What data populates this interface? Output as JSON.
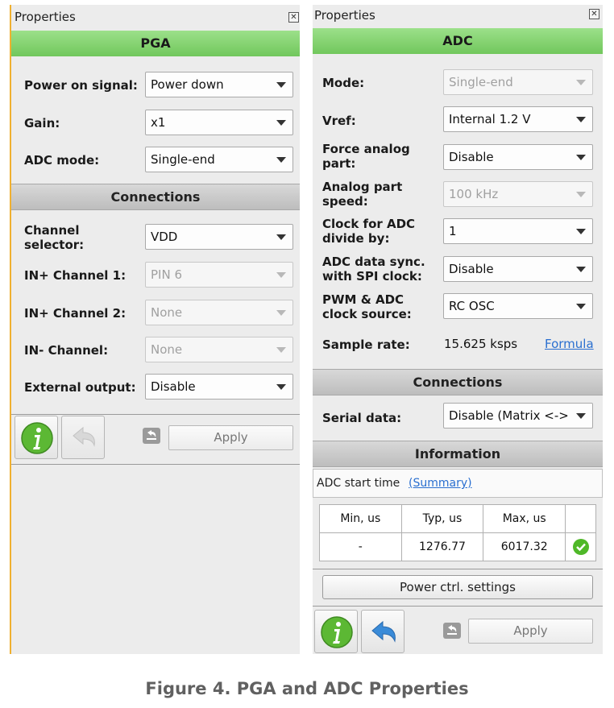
{
  "pga_panel": {
    "window_title": "Properties",
    "header": "PGA",
    "fields": [
      {
        "label": "Power on signal:",
        "value": "Power down"
      },
      {
        "label": "Gain:",
        "value": "x1"
      },
      {
        "label": "ADC mode:",
        "value": "Single-end"
      }
    ],
    "connections_header": "Connections",
    "connections": [
      {
        "label": "Channel selector:",
        "value": "VDD"
      },
      {
        "label": "IN+ Channel 1:",
        "value": "PIN 6"
      },
      {
        "label": "IN+ Channel 2:",
        "value": "None"
      },
      {
        "label": "IN- Channel:",
        "value": "None"
      },
      {
        "label": "External output:",
        "value": "Disable"
      }
    ],
    "apply_label": "Apply"
  },
  "adc_panel": {
    "window_title": "Properties",
    "header": "ADC",
    "fields": [
      {
        "label": "Mode:",
        "value": "Single-end"
      },
      {
        "label": "Vref:",
        "value": "Internal 1.2 V"
      },
      {
        "label": "Force analog part:",
        "value": "Disable"
      },
      {
        "label": "Analog part speed:",
        "value": "100 kHz"
      },
      {
        "label": "Clock for ADC divide by:",
        "value": "1"
      },
      {
        "label": "ADC data sync. with SPI clock:",
        "value": "Disable"
      },
      {
        "label": "PWM & ADC clock source:",
        "value": "RC OSC"
      }
    ],
    "sample_rate": {
      "label": "Sample rate:",
      "value": "15.625 ksps",
      "link": "Formula"
    },
    "connections_header": "Connections",
    "serial_data": {
      "label": "Serial data:",
      "value": "Disable (Matrix <-> "
    },
    "information_header": "Information",
    "start_time": {
      "label": "ADC start time",
      "link": "(Summary)"
    },
    "timing_table": {
      "headers": [
        "Min, us",
        "Typ, us",
        "Max, us"
      ],
      "row": [
        "-",
        "1276.77",
        "6017.32"
      ]
    },
    "power_button": "Power ctrl. settings",
    "apply_label": "Apply"
  },
  "caption": "Figure 4. PGA and ADC Properties",
  "colors": {
    "header_green": "#7fd16a",
    "section_gray": "#c8c8c8",
    "info_green": "#5cb834",
    "undo_blue": "#3a8bd8",
    "link_blue": "#2a6fd0",
    "accent_orange": "#f0b030"
  }
}
